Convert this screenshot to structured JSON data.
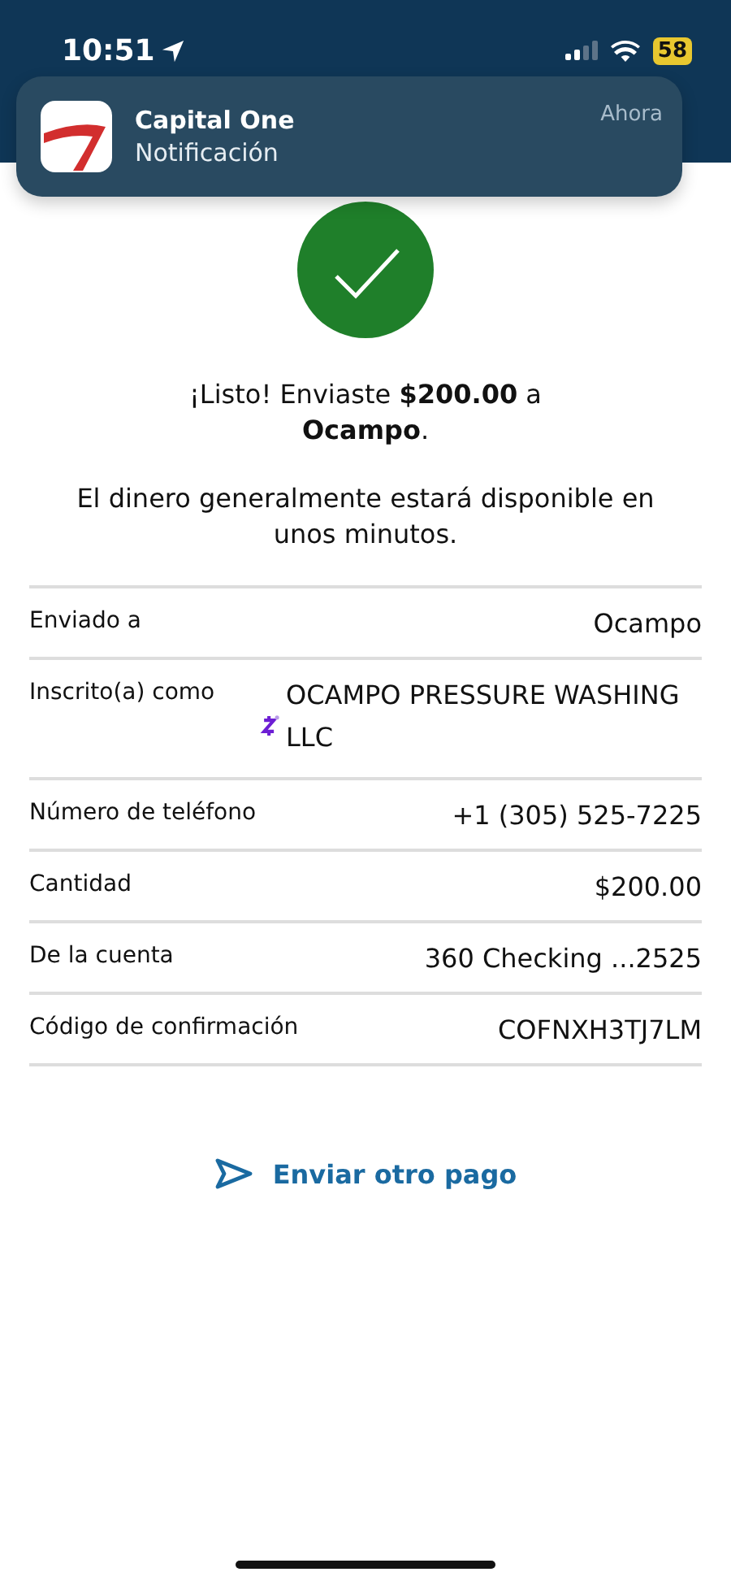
{
  "status_bar": {
    "time": "10:51",
    "battery": "58"
  },
  "notification": {
    "app": "Capital One",
    "text": "Notificación",
    "time": "Ahora"
  },
  "success": {
    "message": "¡Listo! Enviaste **$200.00** a **Ocampo**.",
    "note": "El dinero generalmente estará disponible en unos minutos."
  },
  "details": [
    {
      "label": "Enviado a",
      "value": "Ocampo",
      "kind": "plain"
    },
    {
      "label": "Inscrito(a) como",
      "value": "OCAMPO PRESSURE WASHING LLC",
      "kind": "zelle"
    },
    {
      "label": "Número de teléfono",
      "value": "+1 (305) 525-7225",
      "kind": "plain"
    },
    {
      "label": "Cantidad",
      "value": "$200.00",
      "kind": "plain"
    },
    {
      "label": "De la cuenta",
      "value": "360 Checking ...2525",
      "kind": "plain"
    },
    {
      "label": "Código de confirmación",
      "value": "COFNXH3TJ7LM",
      "kind": "plain"
    }
  ],
  "action": {
    "label": "Enviar otro pago"
  }
}
